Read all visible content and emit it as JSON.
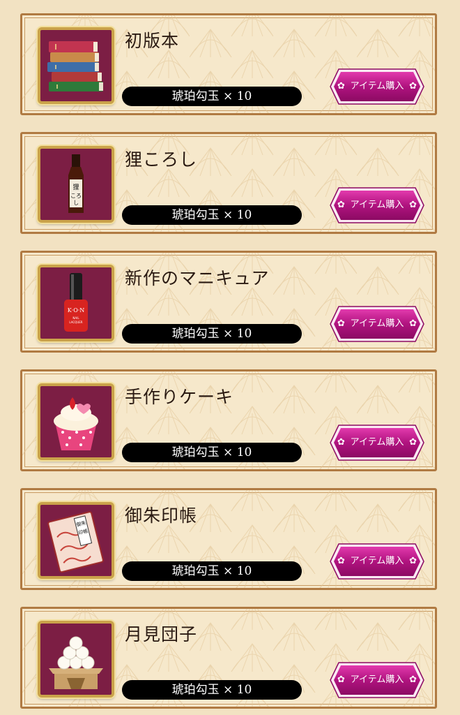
{
  "items": [
    {
      "name": "初版本",
      "price": "琥珀勾玉 × 10",
      "button": "アイテム購入",
      "icon": "books-icon"
    },
    {
      "name": "狸ころし",
      "price": "琥珀勾玉 × 10",
      "button": "アイテム購入",
      "icon": "sake-bottle-icon"
    },
    {
      "name": "新作のマニキュア",
      "price": "琥珀勾玉 × 10",
      "button": "アイテム購入",
      "icon": "nail-polish-icon"
    },
    {
      "name": "手作りケーキ",
      "price": "琥珀勾玉 × 10",
      "button": "アイテム購入",
      "icon": "cupcake-icon"
    },
    {
      "name": "御朱印帳",
      "price": "琥珀勾玉 × 10",
      "button": "アイテム購入",
      "icon": "goshuin-book-icon"
    },
    {
      "name": "月見団子",
      "price": "琥珀勾玉 × 10",
      "button": "アイテム購入",
      "icon": "tsukimi-dango-icon"
    }
  ],
  "colors": {
    "frame": "#b07a42",
    "thumb_bg": "#7c1e44",
    "button": "#b0137f",
    "background": "#f2e2c2"
  }
}
